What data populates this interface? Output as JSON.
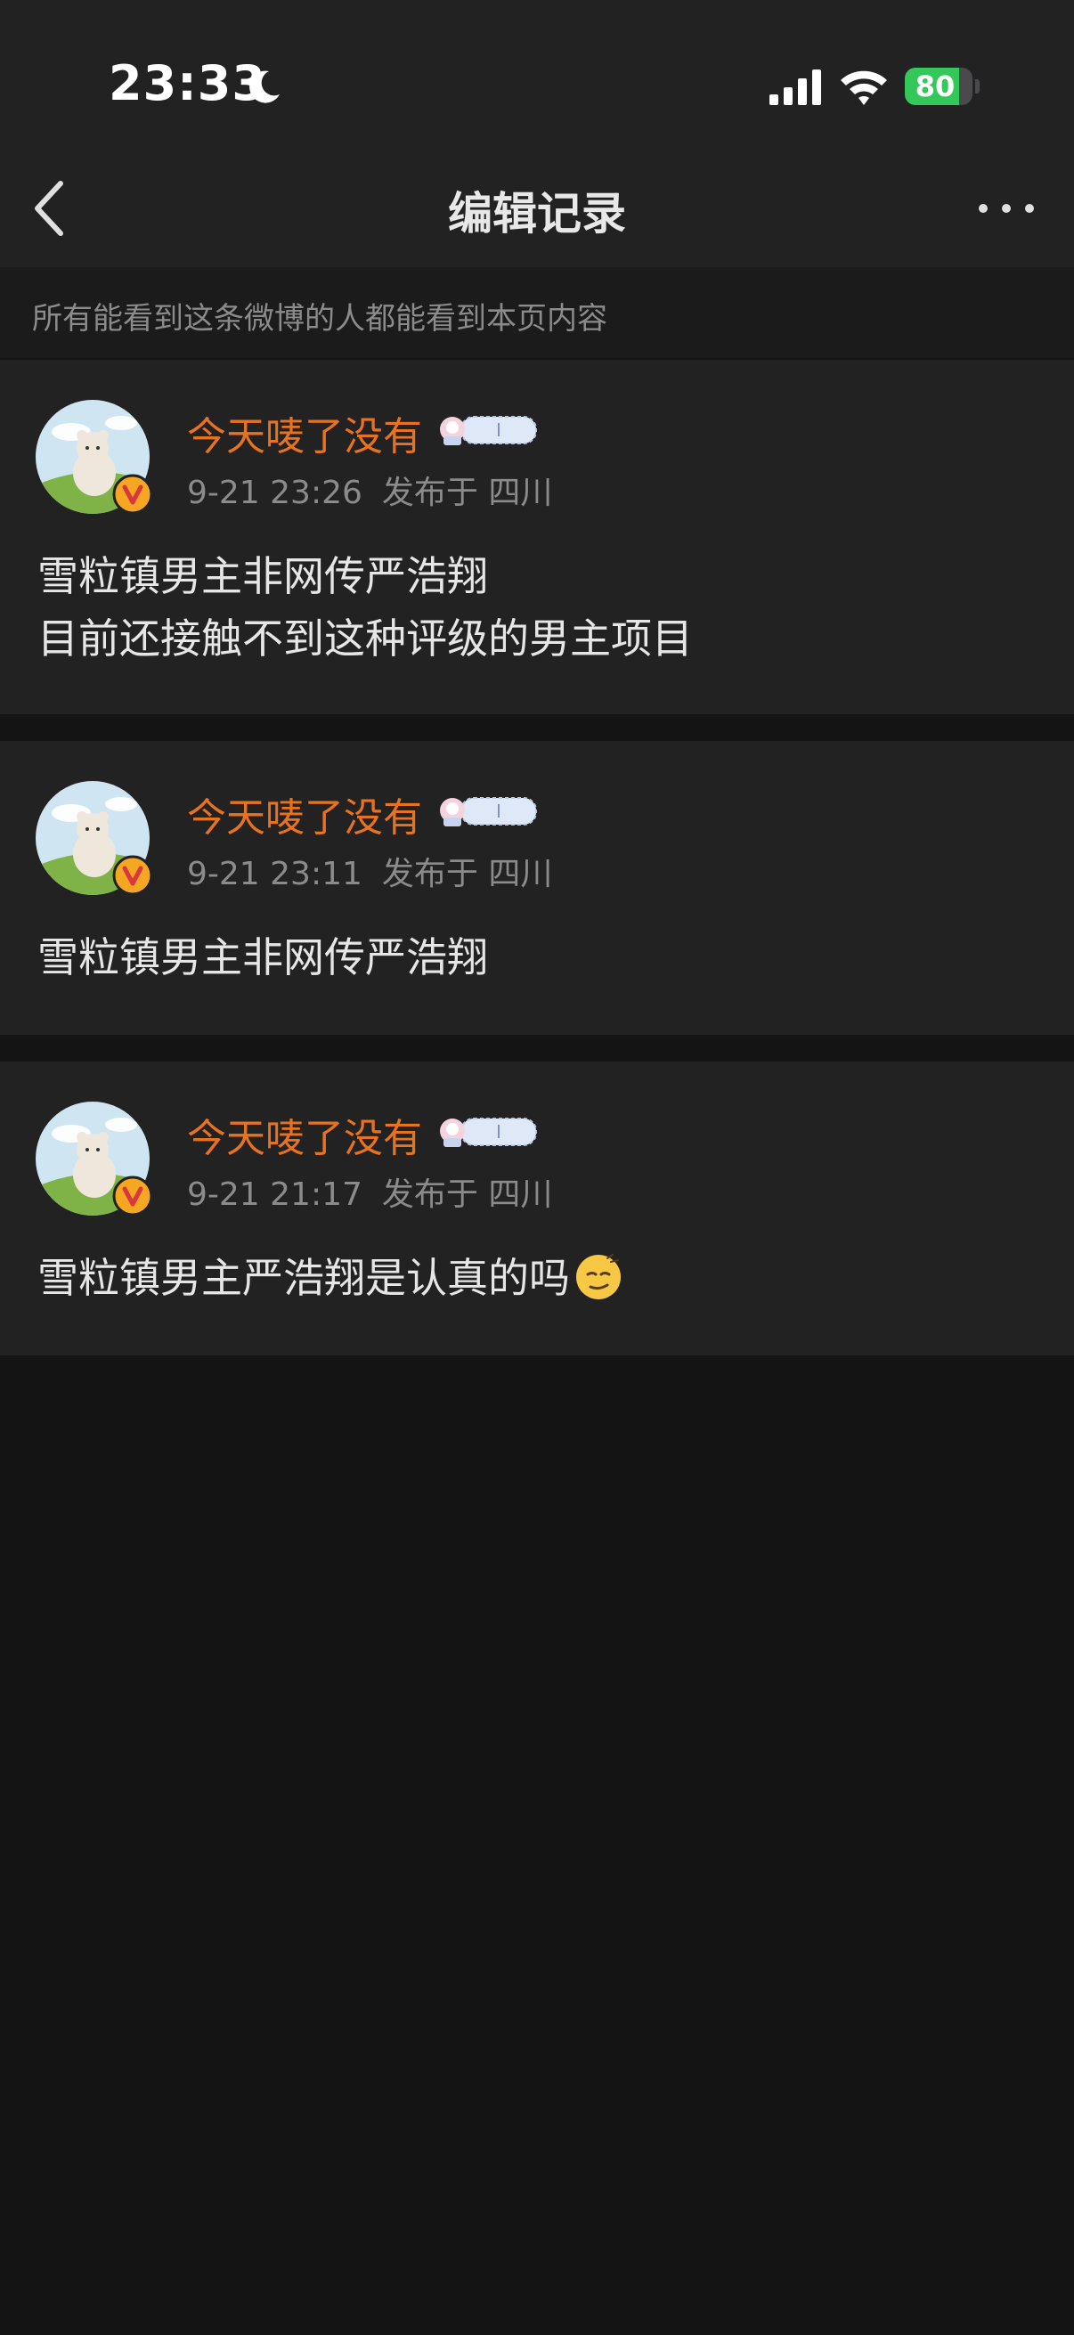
{
  "status_bar": {
    "time": "23:33",
    "battery_level": "80",
    "battery_fraction": 0.8,
    "icons": [
      "moon-icon",
      "signal-icon",
      "wifi-icon",
      "battery-charging-icon"
    ]
  },
  "nav": {
    "title": "编辑记录",
    "back_icon": "chevron-left-icon",
    "more_icon": "more-dots-icon"
  },
  "notice": {
    "text": "所有能看到这条微博的人都能看到本页内容"
  },
  "colors": {
    "background": "#141414",
    "card": "#222223",
    "username": "#e8721d",
    "verified_badge": "#f5a623",
    "meta": "#8b8b8b"
  },
  "posts": [
    {
      "username": "今天唛了没有",
      "time": "9-21 23:26",
      "location": "发布于 四川",
      "lines": [
        "雪粒镇男主非网传严浩翔",
        "目前还接触不到这种评级的男主项目"
      ],
      "has_emoji": false
    },
    {
      "username": "今天唛了没有",
      "time": "9-21 23:11",
      "location": "发布于 四川",
      "lines": [
        "雪粒镇男主非网传严浩翔"
      ],
      "has_emoji": false
    },
    {
      "username": "今天唛了没有",
      "time": "9-21 21:17",
      "location": "发布于 四川",
      "lines": [
        "雪粒镇男主严浩翔是认真的吗"
      ],
      "has_emoji": true,
      "emoji": "smirk-face-icon"
    }
  ]
}
